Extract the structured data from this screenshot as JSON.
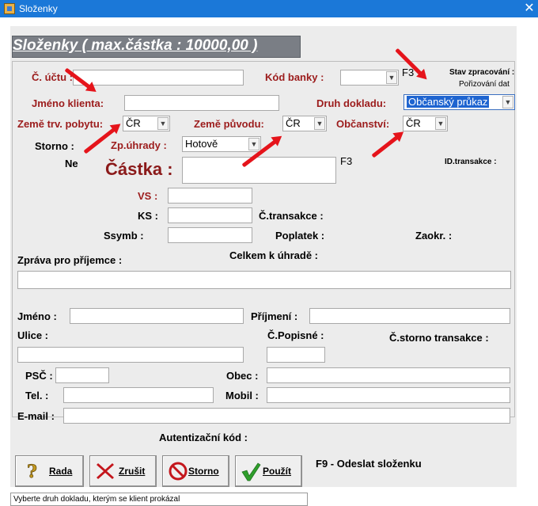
{
  "window": {
    "title": "Složenky",
    "close_glyph": "✕"
  },
  "header": {
    "title": "Složenky ( max.částka : 10000,00 )"
  },
  "status": {
    "label": "Stav zpracování :",
    "value": "Pořizování dat"
  },
  "fields": {
    "cislo_uctu": "Č. účtu :",
    "kod_banky": "Kód banky :",
    "kod_banky_value": "",
    "f3_top": "F3",
    "jmeno_klienta": "Jméno klienta:",
    "druh_dokladu": "Druh dokladu:",
    "druh_dokladu_value": "Občanský průkaz",
    "zeme_trv_pobytu": "Země trv. pobytu:",
    "zeme_trv_pobytu_value": "ČR",
    "zeme_puvodu": "Země původu:",
    "zeme_puvodu_value": "ČR",
    "obcanstvi": "Občanství:",
    "obcanstvi_value": "ČR",
    "storno": "Storno :",
    "storno_value": "Ne",
    "zp_uhrady": "Zp.úhrady :",
    "zp_uhrady_value": "Hotově",
    "castka": "Částka :",
    "f3_castka": "F3",
    "id_transakce": "ID.transakce :",
    "vs": "VS :",
    "ks": "KS :",
    "c_transakce": "Č.transakce :",
    "ssymb": "Ssymb :",
    "poplatek": "Poplatek :",
    "zaokr": "Zaokr. :",
    "zprava": "Zpráva pro příjemce :",
    "celkem": "Celkem k úhradě :",
    "jmeno": "Jméno :",
    "prijmeni": "Příjmení :",
    "ulice": "Ulice :",
    "c_popisne": "Č.Popisné :",
    "c_storno_transakce": "Č.storno transakce :",
    "psc": "PSČ :",
    "obec": "Obec :",
    "tel": "Tel. :",
    "mobil": "Mobil :",
    "email": "E-mail :",
    "autentizacni_kod": "Autentizační kód :"
  },
  "buttons": {
    "rada": "Rada",
    "zrusit": "Zrušit",
    "storno": "Storno",
    "pouzit": "Použít"
  },
  "hint": "F9 - Odeslat složenku",
  "statusbar": "Vyberte druh dokladu, kterým se klient prokázal",
  "colors": {
    "label_red": "#9c1c1c",
    "arrow_red": "#e5141b",
    "header_bg": "#7a7e85",
    "titlebar": "#1b78d8"
  }
}
